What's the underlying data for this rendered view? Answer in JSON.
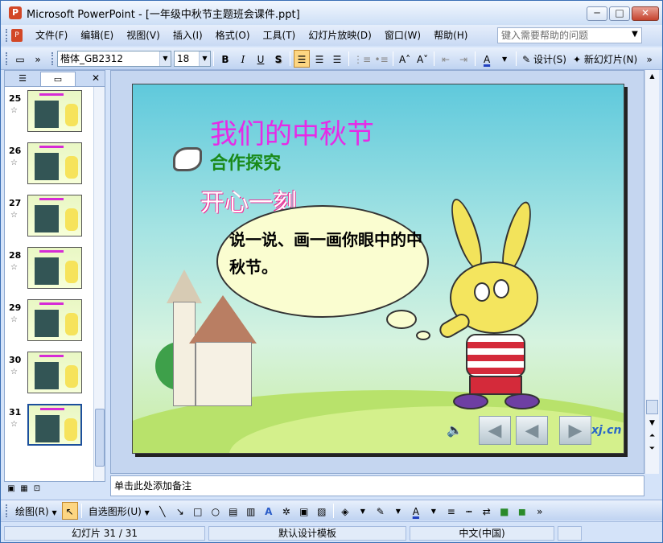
{
  "window": {
    "title": "Microsoft PowerPoint - [一年级中秋节主题班会课件.ppt]",
    "app_letter": "P"
  },
  "window_controls": {
    "minimize": "─",
    "maximize": "□",
    "close": "✕"
  },
  "menu": {
    "items": [
      "文件(F)",
      "编辑(E)",
      "视图(V)",
      "插入(I)",
      "格式(O)",
      "工具(T)",
      "幻灯片放映(D)",
      "窗口(W)",
      "帮助(H)"
    ],
    "help_placeholder": "键入需要帮助的问题"
  },
  "format_toolbar": {
    "font_name": "楷体_GB2312",
    "font_size": "18",
    "bold": "B",
    "italic": "I",
    "underline": "U",
    "shadow": "S",
    "design_label": "设计(S)",
    "new_slide_label": "新幻灯片(N)"
  },
  "left_pane": {
    "close": "✕",
    "thumbnails": [
      {
        "number": "25"
      },
      {
        "number": "26"
      },
      {
        "number": "27"
      },
      {
        "number": "28"
      },
      {
        "number": "29"
      },
      {
        "number": "30"
      },
      {
        "number": "31"
      }
    ],
    "selected": "31"
  },
  "slide": {
    "title": "我们的中秋节",
    "subtitle": "合作探究",
    "wave_text": "开心一刻",
    "bubble_text": "说一说、画一画你眼中的中秋节。",
    "brand": "xj.cn"
  },
  "notes": {
    "placeholder": "单击此处添加备注"
  },
  "drawing_toolbar": {
    "draw_label": "绘图(R)",
    "autoshape_label": "自选图形(U)"
  },
  "status": {
    "slide_counter": "幻灯片 31 / 31",
    "template": "默认设计模板",
    "language": "中文(中国)"
  }
}
